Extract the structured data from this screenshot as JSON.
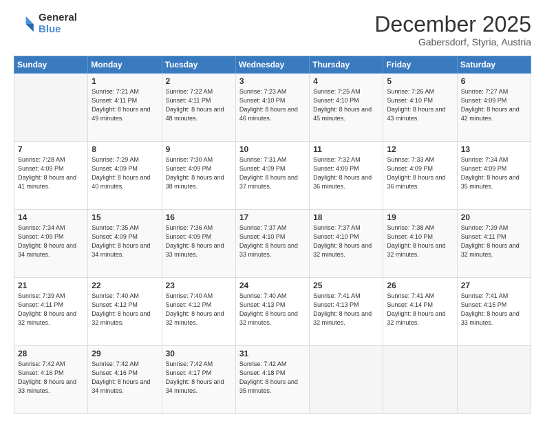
{
  "logo": {
    "general": "General",
    "blue": "Blue"
  },
  "header": {
    "month": "December 2025",
    "location": "Gabersdorf, Styria, Austria"
  },
  "weekdays": [
    "Sunday",
    "Monday",
    "Tuesday",
    "Wednesday",
    "Thursday",
    "Friday",
    "Saturday"
  ],
  "weeks": [
    [
      {
        "day": "",
        "empty": true
      },
      {
        "day": "1",
        "sunrise": "7:21 AM",
        "sunset": "4:11 PM",
        "daylight": "8 hours and 49 minutes."
      },
      {
        "day": "2",
        "sunrise": "7:22 AM",
        "sunset": "4:11 PM",
        "daylight": "8 hours and 48 minutes."
      },
      {
        "day": "3",
        "sunrise": "7:23 AM",
        "sunset": "4:10 PM",
        "daylight": "8 hours and 46 minutes."
      },
      {
        "day": "4",
        "sunrise": "7:25 AM",
        "sunset": "4:10 PM",
        "daylight": "8 hours and 45 minutes."
      },
      {
        "day": "5",
        "sunrise": "7:26 AM",
        "sunset": "4:10 PM",
        "daylight": "8 hours and 43 minutes."
      },
      {
        "day": "6",
        "sunrise": "7:27 AM",
        "sunset": "4:09 PM",
        "daylight": "8 hours and 42 minutes."
      }
    ],
    [
      {
        "day": "7",
        "sunrise": "7:28 AM",
        "sunset": "4:09 PM",
        "daylight": "8 hours and 41 minutes."
      },
      {
        "day": "8",
        "sunrise": "7:29 AM",
        "sunset": "4:09 PM",
        "daylight": "8 hours and 40 minutes."
      },
      {
        "day": "9",
        "sunrise": "7:30 AM",
        "sunset": "4:09 PM",
        "daylight": "8 hours and 38 minutes."
      },
      {
        "day": "10",
        "sunrise": "7:31 AM",
        "sunset": "4:09 PM",
        "daylight": "8 hours and 37 minutes."
      },
      {
        "day": "11",
        "sunrise": "7:32 AM",
        "sunset": "4:09 PM",
        "daylight": "8 hours and 36 minutes."
      },
      {
        "day": "12",
        "sunrise": "7:33 AM",
        "sunset": "4:09 PM",
        "daylight": "8 hours and 36 minutes."
      },
      {
        "day": "13",
        "sunrise": "7:34 AM",
        "sunset": "4:09 PM",
        "daylight": "8 hours and 35 minutes."
      }
    ],
    [
      {
        "day": "14",
        "sunrise": "7:34 AM",
        "sunset": "4:09 PM",
        "daylight": "8 hours and 34 minutes."
      },
      {
        "day": "15",
        "sunrise": "7:35 AM",
        "sunset": "4:09 PM",
        "daylight": "8 hours and 34 minutes."
      },
      {
        "day": "16",
        "sunrise": "7:36 AM",
        "sunset": "4:09 PM",
        "daylight": "8 hours and 33 minutes."
      },
      {
        "day": "17",
        "sunrise": "7:37 AM",
        "sunset": "4:10 PM",
        "daylight": "8 hours and 33 minutes."
      },
      {
        "day": "18",
        "sunrise": "7:37 AM",
        "sunset": "4:10 PM",
        "daylight": "8 hours and 32 minutes."
      },
      {
        "day": "19",
        "sunrise": "7:38 AM",
        "sunset": "4:10 PM",
        "daylight": "8 hours and 32 minutes."
      },
      {
        "day": "20",
        "sunrise": "7:39 AM",
        "sunset": "4:11 PM",
        "daylight": "8 hours and 32 minutes."
      }
    ],
    [
      {
        "day": "21",
        "sunrise": "7:39 AM",
        "sunset": "4:11 PM",
        "daylight": "8 hours and 32 minutes."
      },
      {
        "day": "22",
        "sunrise": "7:40 AM",
        "sunset": "4:12 PM",
        "daylight": "8 hours and 32 minutes."
      },
      {
        "day": "23",
        "sunrise": "7:40 AM",
        "sunset": "4:12 PM",
        "daylight": "8 hours and 32 minutes."
      },
      {
        "day": "24",
        "sunrise": "7:40 AM",
        "sunset": "4:13 PM",
        "daylight": "8 hours and 32 minutes."
      },
      {
        "day": "25",
        "sunrise": "7:41 AM",
        "sunset": "4:13 PM",
        "daylight": "8 hours and 32 minutes."
      },
      {
        "day": "26",
        "sunrise": "7:41 AM",
        "sunset": "4:14 PM",
        "daylight": "8 hours and 32 minutes."
      },
      {
        "day": "27",
        "sunrise": "7:41 AM",
        "sunset": "4:15 PM",
        "daylight": "8 hours and 33 minutes."
      }
    ],
    [
      {
        "day": "28",
        "sunrise": "7:42 AM",
        "sunset": "4:16 PM",
        "daylight": "8 hours and 33 minutes."
      },
      {
        "day": "29",
        "sunrise": "7:42 AM",
        "sunset": "4:16 PM",
        "daylight": "8 hours and 34 minutes."
      },
      {
        "day": "30",
        "sunrise": "7:42 AM",
        "sunset": "4:17 PM",
        "daylight": "8 hours and 34 minutes."
      },
      {
        "day": "31",
        "sunrise": "7:42 AM",
        "sunset": "4:18 PM",
        "daylight": "8 hours and 35 minutes."
      },
      {
        "day": "",
        "empty": true
      },
      {
        "day": "",
        "empty": true
      },
      {
        "day": "",
        "empty": true
      }
    ]
  ]
}
